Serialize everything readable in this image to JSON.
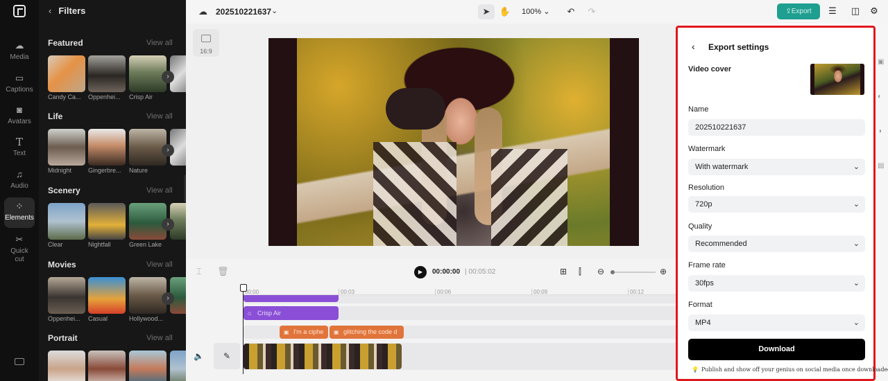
{
  "nav": {
    "items": [
      {
        "id": "media",
        "label": "Media",
        "icon": "cloud-icon"
      },
      {
        "id": "captions",
        "label": "Captions",
        "icon": "captions-icon"
      },
      {
        "id": "avatars",
        "label": "Avatars",
        "icon": "avatar-icon"
      },
      {
        "id": "text",
        "label": "Text",
        "icon": "text-icon"
      },
      {
        "id": "audio",
        "label": "Audio",
        "icon": "audio-icon"
      },
      {
        "id": "elements",
        "label": "Elements",
        "icon": "elements-icon",
        "active": true
      },
      {
        "id": "quickcut",
        "label": "Quick cut",
        "icon": "scissors-icon"
      }
    ]
  },
  "filters": {
    "title": "Filters",
    "view_all": "View all",
    "sections": [
      {
        "title": "Featured",
        "items": [
          "Candy Ca...",
          "Oppenhei...",
          "Crisp Air"
        ]
      },
      {
        "title": "Life",
        "items": [
          "Midnight",
          "Gingerbre...",
          "Nature"
        ]
      },
      {
        "title": "Scenery",
        "items": [
          "Clear",
          "Nightfall",
          "Green Lake"
        ]
      },
      {
        "title": "Movies",
        "items": [
          "Oppenhei...",
          "Casual",
          "Hollywood..."
        ]
      },
      {
        "title": "Portrait",
        "items": [
          "",
          "",
          ""
        ]
      }
    ]
  },
  "topbar": {
    "project_name": "202510221637",
    "zoom": "100%",
    "export_label": "Export"
  },
  "canvas": {
    "aspect_ratio": "16:9"
  },
  "timeline": {
    "current_time": "00:00:00",
    "total_time": "00:05:02",
    "ruler": [
      "00:00",
      "00:03",
      "00:06",
      "00:09",
      "00:12"
    ],
    "clips": {
      "filter": "Crisp Air",
      "text1": "I'm a ciphe",
      "text2": "glitching the code d"
    }
  },
  "export_settings": {
    "title": "Export settings",
    "video_cover_label": "Video cover",
    "name_label": "Name",
    "name_value": "202510221637",
    "watermark_label": "Watermark",
    "watermark_value": "With watermark",
    "resolution_label": "Resolution",
    "resolution_value": "720p",
    "quality_label": "Quality",
    "quality_value": "Recommended",
    "frame_rate_label": "Frame rate",
    "frame_rate_value": "30fps",
    "format_label": "Format",
    "format_value": "MP4",
    "download_label": "Download",
    "hint": "Publish and show off your genius on social media once downloaded.",
    "highlight_color": "#e0161d"
  }
}
